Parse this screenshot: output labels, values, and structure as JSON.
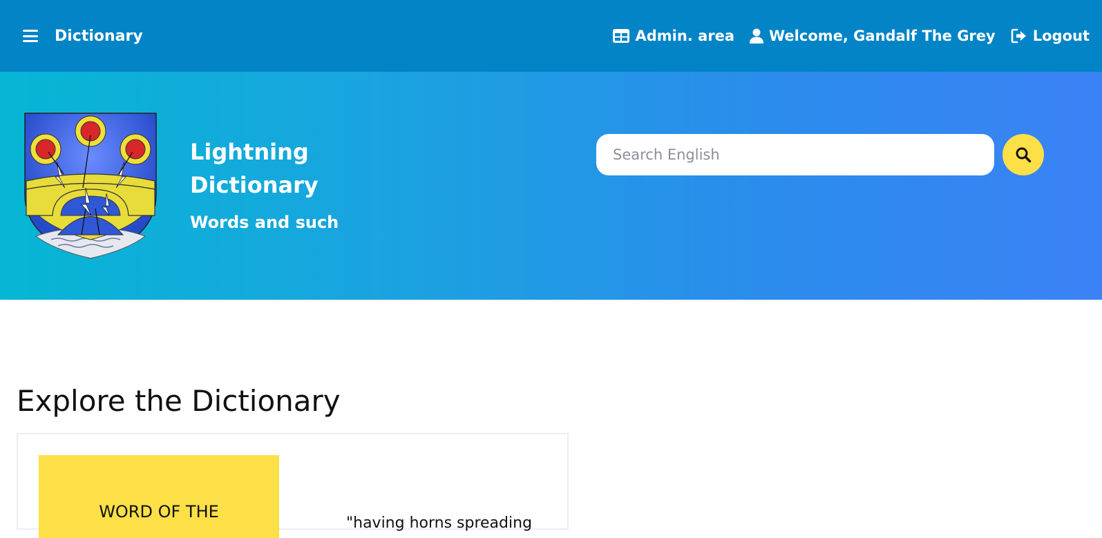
{
  "navbar": {
    "brand": "Dictionary",
    "admin_label": "Admin. area",
    "welcome_label": "Welcome, Gandalf The Grey",
    "logout_label": "Logout"
  },
  "hero": {
    "title": "Lightning Dictionary",
    "subtitle": "Words and such",
    "search_placeholder": "Search English"
  },
  "main": {
    "section_title": "Explore the Dictionary",
    "word_of_the_day_label": "WORD OF THE",
    "definition_snippet": "\"having horns spreading"
  },
  "colors": {
    "navbar": "#0284c7",
    "hero_start": "#06b6d4",
    "hero_end": "#3b82f6",
    "accent_yellow": "#fde047"
  },
  "icons": [
    "menu-icon",
    "table-icon",
    "user-icon",
    "logout-icon",
    "search-icon",
    "coat-of-arms-logo"
  ]
}
